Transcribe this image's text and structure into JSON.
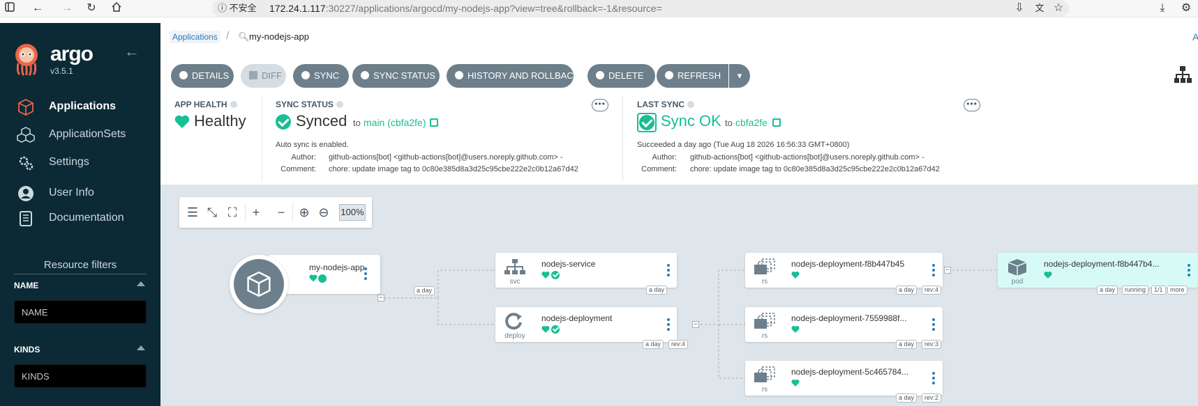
{
  "browser": {
    "security_label": "不安全",
    "url_host": "172.24.1.117",
    "url_rest": ":30227/applications/argocd/my-nodejs-app?view=tree&rollback=-1&resource="
  },
  "sidebar": {
    "brand": "argo",
    "version": "v3.5.1",
    "nav": [
      {
        "label": "Applications",
        "icon": "cube-icon"
      },
      {
        "label": "ApplicationSets",
        "icon": "cubes-icon"
      },
      {
        "label": "Settings",
        "icon": "gears-icon"
      },
      {
        "label": "User Info",
        "icon": "user-icon"
      },
      {
        "label": "Documentation",
        "icon": "book-icon"
      }
    ],
    "filters": {
      "title": "Resource filters",
      "name_label": "NAME",
      "name_placeholder": "NAME",
      "kinds_label": "KINDS",
      "kinds_placeholder": "KINDS"
    }
  },
  "topbar": {
    "crumb_apps": "Applications",
    "crumb_sep": "/",
    "app_name": "my-nodejs-app",
    "right_text": "A"
  },
  "toolbar": {
    "details": "DETAILS",
    "diff": "DIFF",
    "sync": "SYNC",
    "sync_status": "SYNC STATUS",
    "history": "HISTORY AND ROLLBACK",
    "delete": "DELETE",
    "refresh": "REFRESH"
  },
  "status": {
    "health": {
      "title": "APP HEALTH",
      "value": "Healthy"
    },
    "sync": {
      "title": "SYNC STATUS",
      "value": "Synced",
      "to": "to",
      "revision": "main (cbfa2fe)",
      "auto": "Auto sync is enabled.",
      "author_label": "Author:",
      "author": "github-actions[bot] <github-actions[bot]@users.noreply.github.com> -",
      "comment_label": "Comment:",
      "comment": "chore: update image tag to 0c80e385d8a3d25c95cbe222e2c0b12a67d42"
    },
    "last_sync": {
      "title": "LAST SYNC",
      "value": "Sync OK",
      "to": "to",
      "revision": "cbfa2fe",
      "succeeded": "Succeeded a day ago (Tue Aug 18 2026 16:56:33 GMT+0800)",
      "author_label": "Author:",
      "author": "github-actions[bot] <github-actions[bot]@users.noreply.github.com> -",
      "comment_label": "Comment:",
      "comment": "chore: update image tag to 0c80e385d8a3d25c95cbe222e2c0b12a67d42"
    }
  },
  "canvas": {
    "zoom": "100%",
    "app": {
      "name": "my-nodejs-app",
      "age": "a day"
    },
    "nodes": [
      {
        "id": "svc",
        "name": "nodejs-service",
        "kind": "svc",
        "tags": [
          "a day"
        ]
      },
      {
        "id": "deploy",
        "name": "nodejs-deployment",
        "kind": "deploy",
        "tags": [
          "a day",
          "rev:4"
        ]
      },
      {
        "id": "rs1",
        "name": "nodejs-deployment-f8b447b45",
        "kind": "rs",
        "tags": [
          "a day",
          "rev:4"
        ]
      },
      {
        "id": "rs2",
        "name": "nodejs-deployment-7559988f...",
        "kind": "rs",
        "tags": [
          "a day",
          "rev:3"
        ]
      },
      {
        "id": "rs3",
        "name": "nodejs-deployment-5c465784...",
        "kind": "rs",
        "tags": [
          "a day",
          "rev:2"
        ]
      },
      {
        "id": "pod",
        "name": "nodejs-deployment-f8b447b4...",
        "kind": "pod",
        "tags": [
          "a day",
          "running",
          "1/1",
          "more"
        ]
      }
    ]
  },
  "colors": {
    "sidebar_bg": "#0c2a35",
    "accent_green": "#18be94",
    "button_gray": "#6d7f8b",
    "canvas_bg": "#dee6eb"
  }
}
